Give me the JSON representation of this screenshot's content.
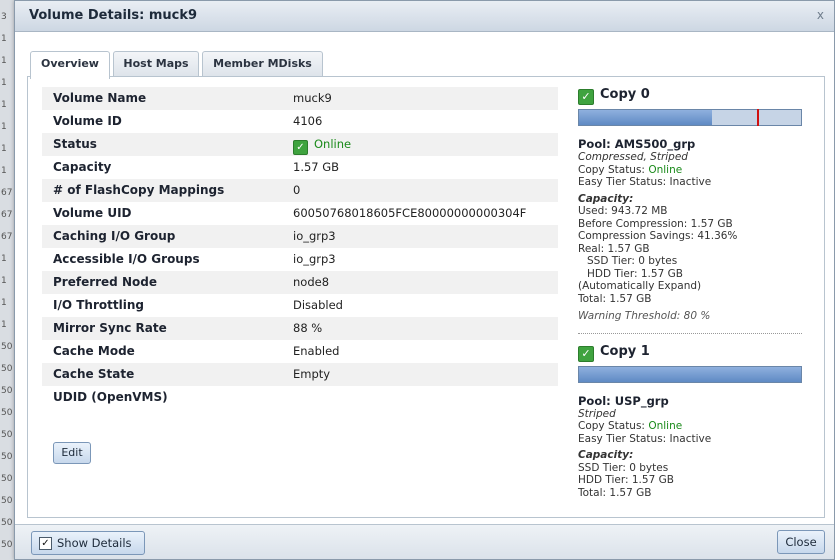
{
  "background": {
    "row_numbers": [
      "3",
      "1",
      "1",
      "1",
      "1",
      "1",
      "1",
      "1",
      "67",
      "67",
      "67",
      "1",
      "1",
      "1",
      "1",
      "50",
      "50",
      "50",
      "50",
      "50",
      "50",
      "50",
      "50",
      "50",
      "50"
    ]
  },
  "dialog": {
    "title": "Volume Details: muck9",
    "close_icon": "x"
  },
  "tabs": [
    {
      "label": "Overview",
      "active": true
    },
    {
      "label": "Host Maps",
      "active": false
    },
    {
      "label": "Member MDisks",
      "active": false
    }
  ],
  "properties": [
    {
      "key": "Volume Name",
      "value": "muck9"
    },
    {
      "key": "Volume ID",
      "value": "4106"
    },
    {
      "key": "Status",
      "value": "Online"
    },
    {
      "key": "Capacity",
      "value": "1.57 GB"
    },
    {
      "key": "# of FlashCopy Mappings",
      "value": "0"
    },
    {
      "key": "Volume UID",
      "value": "60050768018605FCE80000000000304F"
    },
    {
      "key": "Caching I/O Group",
      "value": "io_grp3"
    },
    {
      "key": "Accessible I/O Groups",
      "value": "io_grp3"
    },
    {
      "key": "Preferred Node",
      "value": "node8"
    },
    {
      "key": "I/O Throttling",
      "value": "Disabled"
    },
    {
      "key": "Mirror Sync Rate",
      "value": "88 %"
    },
    {
      "key": "Cache Mode",
      "value": "Enabled"
    },
    {
      "key": "Cache State",
      "value": "Empty"
    },
    {
      "key": "UDID (OpenVMS)",
      "value": ""
    }
  ],
  "edit_label": "Edit",
  "copy0": {
    "title": "Copy 0",
    "used_fraction": 0.6,
    "threshold_fraction": 0.8,
    "pool": "Pool: AMS500_grp",
    "type": "Compressed, Striped",
    "copy_status_label": "Copy Status: ",
    "copy_status": "Online",
    "easy_tier": "Easy Tier Status: Inactive",
    "capacity_heading": "Capacity:",
    "used": "Used: 943.72 MB",
    "before_compression": "Before Compression: 1.57 GB",
    "compression_savings": "Compression Savings: 41.36%",
    "real": "Real: 1.57 GB",
    "ssd_tier": "SSD Tier: 0 bytes",
    "hdd_tier": "HDD Tier: 1.57 GB",
    "auto_expand": "(Automatically Expand)",
    "total": "Total: 1.57 GB",
    "warning": "Warning Threshold: 80 %"
  },
  "copy1": {
    "title": "Copy 1",
    "used_fraction": 1.0,
    "pool": "Pool: USP_grp",
    "type": "Striped",
    "copy_status_label": "Copy Status: ",
    "copy_status": "Online",
    "easy_tier": "Easy Tier Status: Inactive",
    "capacity_heading": "Capacity:",
    "ssd_tier": "SSD Tier: 0 bytes",
    "hdd_tier": "HDD Tier: 1.57 GB",
    "total": "Total: 1.57 GB"
  },
  "footer": {
    "show_details_label": "Show Details",
    "show_details_checked": true,
    "close_label": "Close"
  },
  "colors": {
    "online": "#1a8a1a",
    "threshold_marker": "#d01010",
    "bar_fill": "#5f8ac4"
  }
}
